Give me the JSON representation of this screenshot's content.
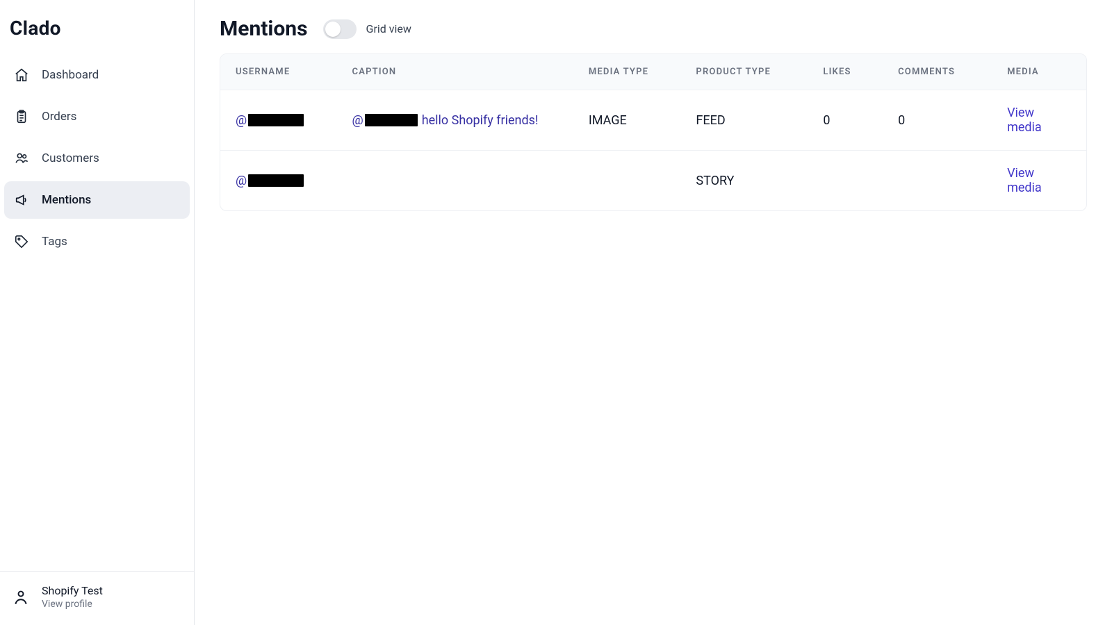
{
  "brand": "Clado",
  "sidebar": {
    "items": [
      {
        "label": "Dashboard",
        "icon": "home-icon",
        "active": false
      },
      {
        "label": "Orders",
        "icon": "clipboard-icon",
        "active": false
      },
      {
        "label": "Customers",
        "icon": "users-icon",
        "active": false
      },
      {
        "label": "Mentions",
        "icon": "megaphone-icon",
        "active": true
      },
      {
        "label": "Tags",
        "icon": "tag-icon",
        "active": false
      }
    ]
  },
  "user": {
    "name": "Shopify Test",
    "view_profile": "View profile"
  },
  "page": {
    "title": "Mentions",
    "grid_view_label": "Grid view",
    "grid_view_on": false
  },
  "table": {
    "headers": {
      "username": "USERNAME",
      "caption": "CAPTION",
      "media_type": "MEDIA TYPE",
      "product_type": "PRODUCT TYPE",
      "likes": "LIKES",
      "comments": "COMMENTS",
      "media": "MEDIA"
    },
    "rows": [
      {
        "username_prefix": "@",
        "username_redacted": true,
        "caption_handle_prefix": "@",
        "caption_handle_redacted": true,
        "caption_text": "hello Shopify friends!",
        "media_type": "IMAGE",
        "product_type": "FEED",
        "likes": "0",
        "comments": "0",
        "media_link": "View media"
      },
      {
        "username_prefix": "@",
        "username_redacted": true,
        "caption_handle_prefix": "",
        "caption_handle_redacted": false,
        "caption_text": "",
        "media_type": "",
        "product_type": "STORY",
        "likes": "",
        "comments": "",
        "media_link": "View media"
      }
    ]
  }
}
